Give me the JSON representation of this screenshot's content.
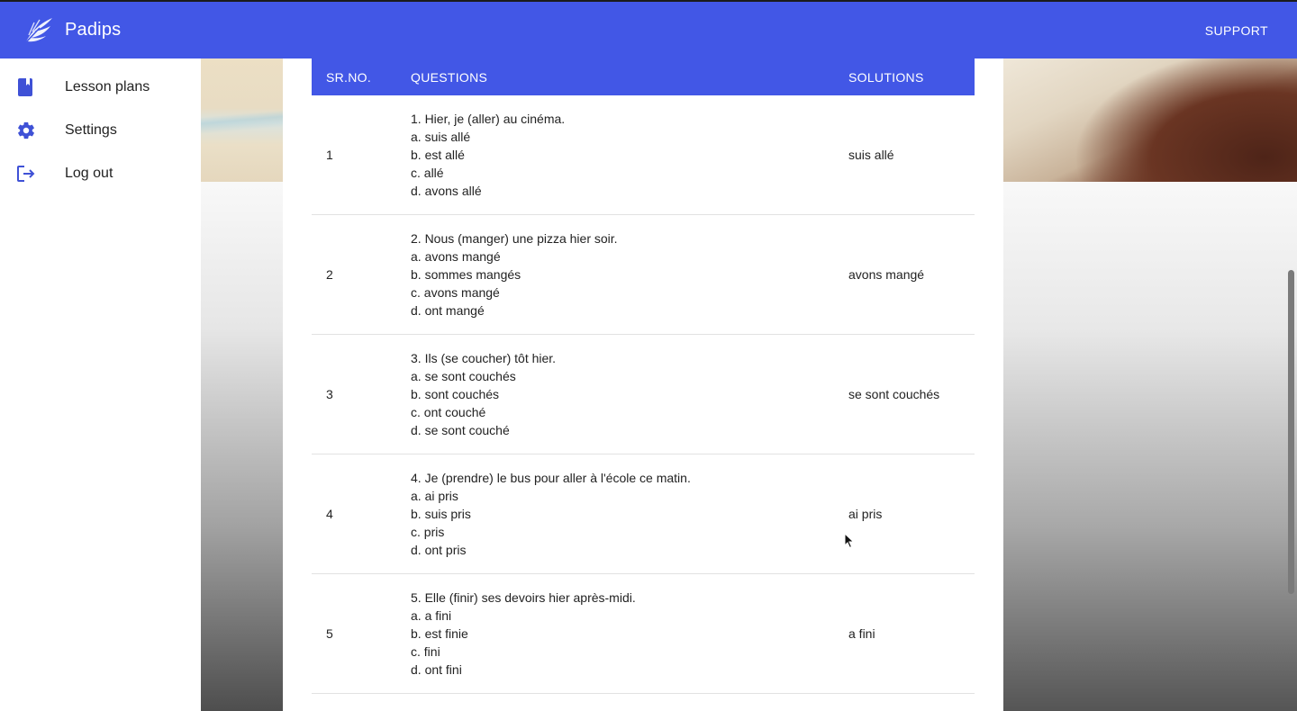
{
  "app": {
    "name": "Padips",
    "support_label": "SUPPORT"
  },
  "sidebar": {
    "items": [
      {
        "label": "Lesson plans",
        "icon": "book-icon"
      },
      {
        "label": "Settings",
        "icon": "gear-icon"
      },
      {
        "label": "Log out",
        "icon": "logout-icon"
      }
    ]
  },
  "table": {
    "headers": {
      "no": "SR.NO.",
      "questions": "QUESTIONS",
      "solutions": "SOLUTIONS"
    },
    "rows": [
      {
        "no": "1",
        "question": "1. Hier, je (aller) au cinéma.",
        "options": [
          "a. suis allé",
          "b. est allé",
          "c. allé",
          "d. avons allé"
        ],
        "solution": "suis allé"
      },
      {
        "no": "2",
        "question": "2. Nous (manger) une pizza hier soir.",
        "options": [
          "a. avons mangé",
          "b. sommes mangés",
          "c. avons mangé",
          "d. ont mangé"
        ],
        "solution": "avons mangé"
      },
      {
        "no": "3",
        "question": "3. Ils (se coucher) tôt hier.",
        "options": [
          "a. se sont couchés",
          "b. sont couchés",
          "c. ont couché",
          "d. se sont couché"
        ],
        "solution": "se sont couchés"
      },
      {
        "no": "4",
        "question": "4. Je (prendre) le bus pour aller à l'école ce matin.",
        "options": [
          "a. ai pris",
          "b. suis pris",
          "c. pris",
          "d. ont pris"
        ],
        "solution": "ai pris"
      },
      {
        "no": "5",
        "question": "5. Elle (finir) ses devoirs hier après-midi.",
        "options": [
          "a. a fini",
          "b. est finie",
          "c. fini",
          "d. ont fini"
        ],
        "solution": "a fini"
      }
    ]
  },
  "colors": {
    "primary": "#4257e6",
    "icon": "#3f51d6"
  }
}
